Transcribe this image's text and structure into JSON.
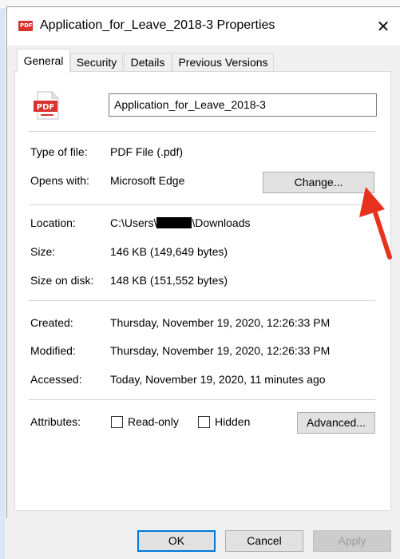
{
  "dialog": {
    "title": "Application_for_Leave_2018-3 Properties",
    "close_glyph": "✕",
    "title_icon_text": "PDF"
  },
  "tabs": [
    {
      "label": "General",
      "active": true
    },
    {
      "label": "Security",
      "active": false
    },
    {
      "label": "Details",
      "active": false
    },
    {
      "label": "Previous Versions",
      "active": false
    }
  ],
  "general": {
    "file_icon_text": "PDF",
    "filename": "Application_for_Leave_2018-3",
    "type_label": "Type of file:",
    "type_value": "PDF File (.pdf)",
    "opens_label": "Opens with:",
    "opens_value": "Microsoft Edge",
    "change_button": "Change...",
    "location_label": "Location:",
    "location_prefix": "C:\\Users\\",
    "location_suffix": "\\Downloads",
    "size_label": "Size:",
    "size_value": "146 KB (149,649 bytes)",
    "size_on_disk_label": "Size on disk:",
    "size_on_disk_value": "148 KB (151,552 bytes)",
    "created_label": "Created:",
    "created_value": "Thursday, November 19, 2020, 12:26:33 PM",
    "modified_label": "Modified:",
    "modified_value": "Thursday, November 19, 2020, 12:26:33 PM",
    "accessed_label": "Accessed:",
    "accessed_value": "Today, November 19, 2020, 11 minutes ago",
    "attributes_label": "Attributes:",
    "readonly_label": "Read-only",
    "hidden_label": "Hidden",
    "advanced_button": "Advanced..."
  },
  "footer": {
    "ok": "OK",
    "cancel": "Cancel",
    "apply": "Apply"
  },
  "colors": {
    "pdf_red": "#d9322b",
    "focus_blue": "#0078d7",
    "annotation_arrow": "#e8321e"
  },
  "icons": {
    "title": "pdf-file-icon",
    "close": "close-icon",
    "file": "pdf-file-icon",
    "annotation": "red-arrow-icon"
  }
}
